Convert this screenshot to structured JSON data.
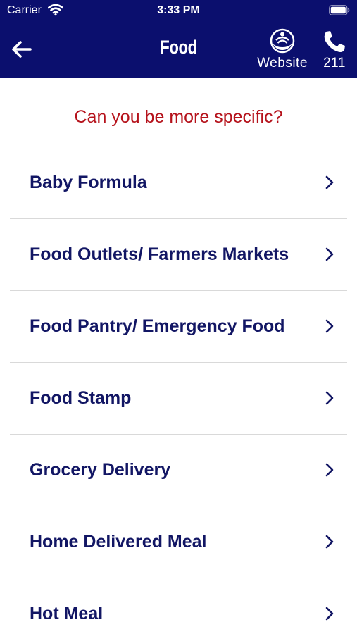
{
  "status_bar": {
    "carrier": "Carrier",
    "time": "3:33 PM"
  },
  "header": {
    "title": "Food",
    "back_icon": "arrow-left-icon",
    "website_label": "Website",
    "website_icon": "united-way-logo-icon",
    "call_label": "211",
    "call_icon": "phone-icon",
    "background_color": "#0b0f6e"
  },
  "prompt": {
    "text": "Can you be more specific?",
    "color": "#b5121b"
  },
  "categories": [
    {
      "label": "Baby Formula"
    },
    {
      "label": "Food Outlets/ Farmers Markets"
    },
    {
      "label": "Food Pantry/ Emergency Food"
    },
    {
      "label": "Food Stamp"
    },
    {
      "label": "Grocery Delivery"
    },
    {
      "label": "Home Delivered Meal"
    },
    {
      "label": "Hot Meal"
    }
  ]
}
